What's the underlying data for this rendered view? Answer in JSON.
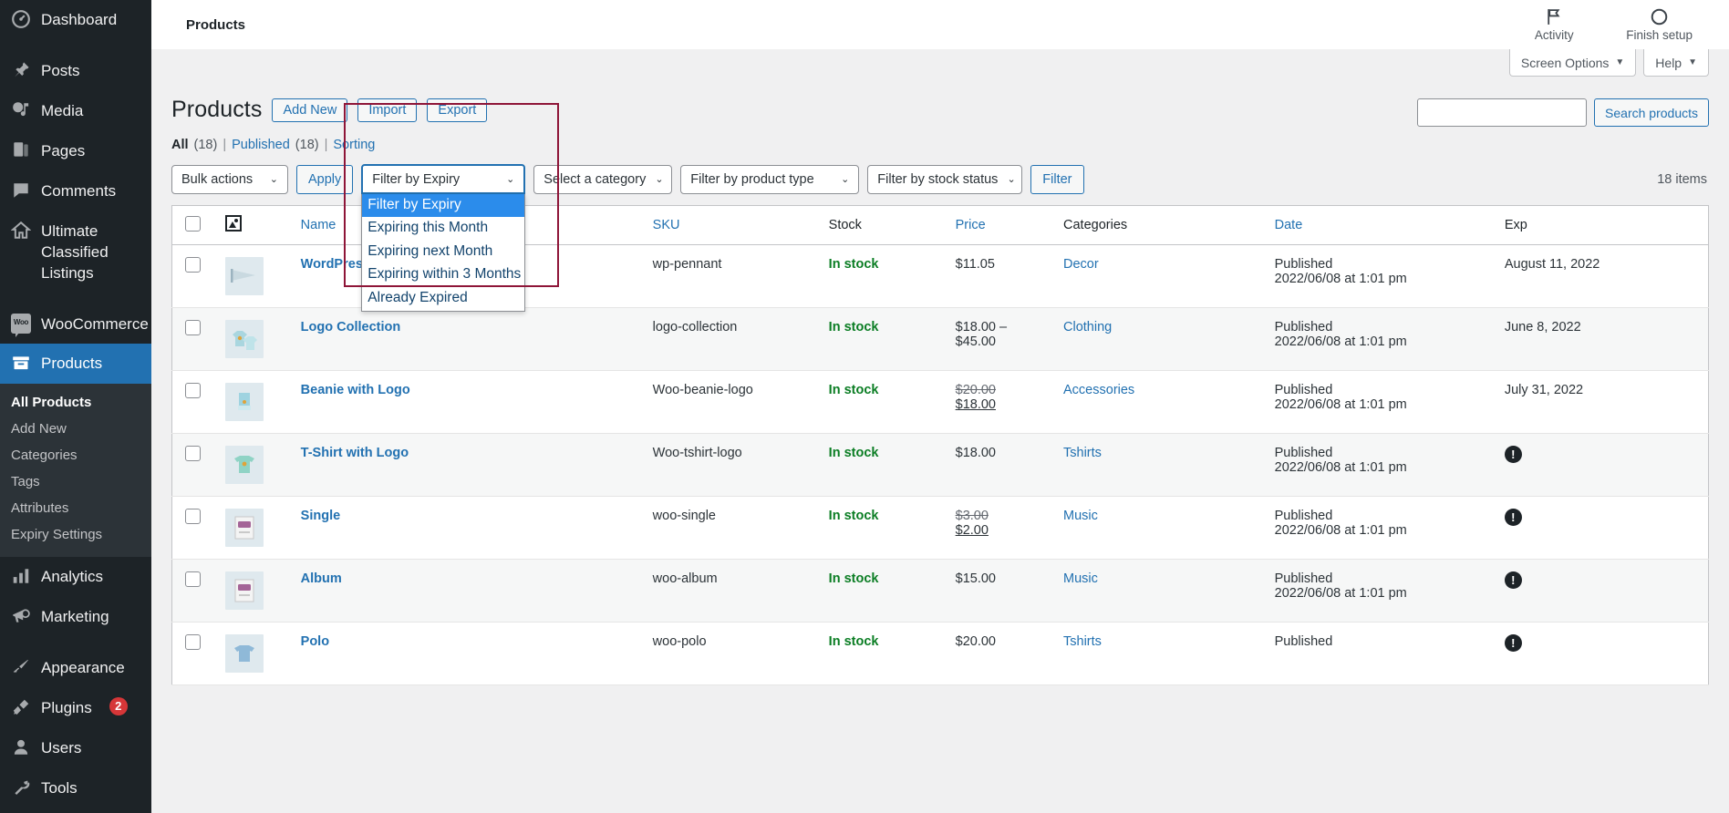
{
  "sidebar": {
    "items": [
      {
        "label": "Dashboard",
        "icon": "dashboard-icon"
      },
      {
        "label": "Posts",
        "icon": "pin-icon"
      },
      {
        "label": "Media",
        "icon": "media-icon"
      },
      {
        "label": "Pages",
        "icon": "pages-icon"
      },
      {
        "label": "Comments",
        "icon": "comments-icon"
      },
      {
        "label": "Ultimate Classified Listings",
        "icon": "home-icon"
      },
      {
        "label": "WooCommerce",
        "icon": "woocommerce-icon"
      },
      {
        "label": "Products",
        "icon": "products-icon"
      },
      {
        "label": "Analytics",
        "icon": "analytics-icon"
      },
      {
        "label": "Marketing",
        "icon": "megaphone-icon"
      },
      {
        "label": "Appearance",
        "icon": "brush-icon"
      },
      {
        "label": "Plugins",
        "icon": "plug-icon",
        "badge": "2"
      },
      {
        "label": "Users",
        "icon": "user-icon"
      },
      {
        "label": "Tools",
        "icon": "wrench-icon"
      }
    ],
    "submenu": [
      {
        "label": "All Products",
        "active": true
      },
      {
        "label": "Add New",
        "active": false
      },
      {
        "label": "Categories",
        "active": false
      },
      {
        "label": "Tags",
        "active": false
      },
      {
        "label": "Attributes",
        "active": false
      },
      {
        "label": "Expiry Settings",
        "active": false
      }
    ],
    "woo_text": "Woo"
  },
  "toolbar": {
    "title": "Products",
    "activity_label": "Activity",
    "finish_setup_label": "Finish setup"
  },
  "screen_meta": {
    "screen_options": "Screen Options",
    "help": "Help",
    "caret": "▼"
  },
  "page": {
    "title": "Products",
    "add_new": "Add New",
    "import": "Import",
    "export": "Export"
  },
  "subsub": {
    "all_label": "All",
    "all_count": "(18)",
    "published_label": "Published",
    "published_count": "(18)",
    "sorting_label": "Sorting",
    "separator": "|"
  },
  "search": {
    "value": "",
    "placeholder": "",
    "button": "Search products"
  },
  "filters": {
    "bulk_actions": "Bulk actions",
    "apply": "Apply",
    "expiry_selected": "Filter by Expiry",
    "expiry_options": [
      "Filter by Expiry",
      "Expiring this Month",
      "Expiring next Month",
      "Expiring within 3 Months",
      "Already Expired"
    ],
    "category": "Select a category",
    "product_type": "Filter by product type",
    "stock_status": "Filter by stock status",
    "filter_button": "Filter",
    "items_count": "18 items",
    "chevron": "⌄"
  },
  "table": {
    "columns": [
      {
        "label": "",
        "key": "cb"
      },
      {
        "label": "",
        "key": "thumb"
      },
      {
        "label": "Name",
        "key": "name",
        "sortable": true
      },
      {
        "label": "SKU",
        "key": "sku",
        "sortable": true
      },
      {
        "label": "Stock",
        "key": "stock",
        "sortable": false
      },
      {
        "label": "Price",
        "key": "price",
        "sortable": true
      },
      {
        "label": "Categories",
        "key": "categories",
        "sortable": false
      },
      {
        "label": "Date",
        "key": "date",
        "sortable": true
      },
      {
        "label": "Exp",
        "key": "exp",
        "sortable": false
      }
    ],
    "rows": [
      {
        "name": "WordPress Pennant",
        "sku": "wp-pennant",
        "stock": "In stock",
        "price": "$11.05",
        "price_old": "",
        "categories": "Decor",
        "date_status": "Published",
        "date_value": "2022/06/08 at 1:01 pm",
        "exp": "August 11, 2022",
        "exp_warning": false
      },
      {
        "name": "Logo Collection",
        "sku": "logo-collection",
        "stock": "In stock",
        "price": "$18.00 – $45.00",
        "price_old": "",
        "categories": "Clothing",
        "date_status": "Published",
        "date_value": "2022/06/08 at 1:01 pm",
        "exp": "June 8, 2022",
        "exp_warning": false
      },
      {
        "name": "Beanie with Logo",
        "sku": "Woo-beanie-logo",
        "stock": "In stock",
        "price": "$18.00",
        "price_old": "$20.00",
        "categories": "Accessories",
        "date_status": "Published",
        "date_value": "2022/06/08 at 1:01 pm",
        "exp": "July 31, 2022",
        "exp_warning": false
      },
      {
        "name": "T-Shirt with Logo",
        "sku": "Woo-tshirt-logo",
        "stock": "In stock",
        "price": "$18.00",
        "price_old": "",
        "categories": "Tshirts",
        "date_status": "Published",
        "date_value": "2022/06/08 at 1:01 pm",
        "exp": "",
        "exp_warning": true
      },
      {
        "name": "Single",
        "sku": "woo-single",
        "stock": "In stock",
        "price": "$2.00",
        "price_old": "$3.00",
        "categories": "Music",
        "date_status": "Published",
        "date_value": "2022/06/08 at 1:01 pm",
        "exp": "",
        "exp_warning": true
      },
      {
        "name": "Album",
        "sku": "woo-album",
        "stock": "In stock",
        "price": "$15.00",
        "price_old": "",
        "categories": "Music",
        "date_status": "Published",
        "date_value": "2022/06/08 at 1:01 pm",
        "exp": "",
        "exp_warning": true
      },
      {
        "name": "Polo",
        "sku": "woo-polo",
        "stock": "In stock",
        "price": "$20.00",
        "price_old": "",
        "categories": "Tshirts",
        "date_status": "Published",
        "date_value": "",
        "exp": "",
        "exp_warning": true
      }
    ]
  }
}
